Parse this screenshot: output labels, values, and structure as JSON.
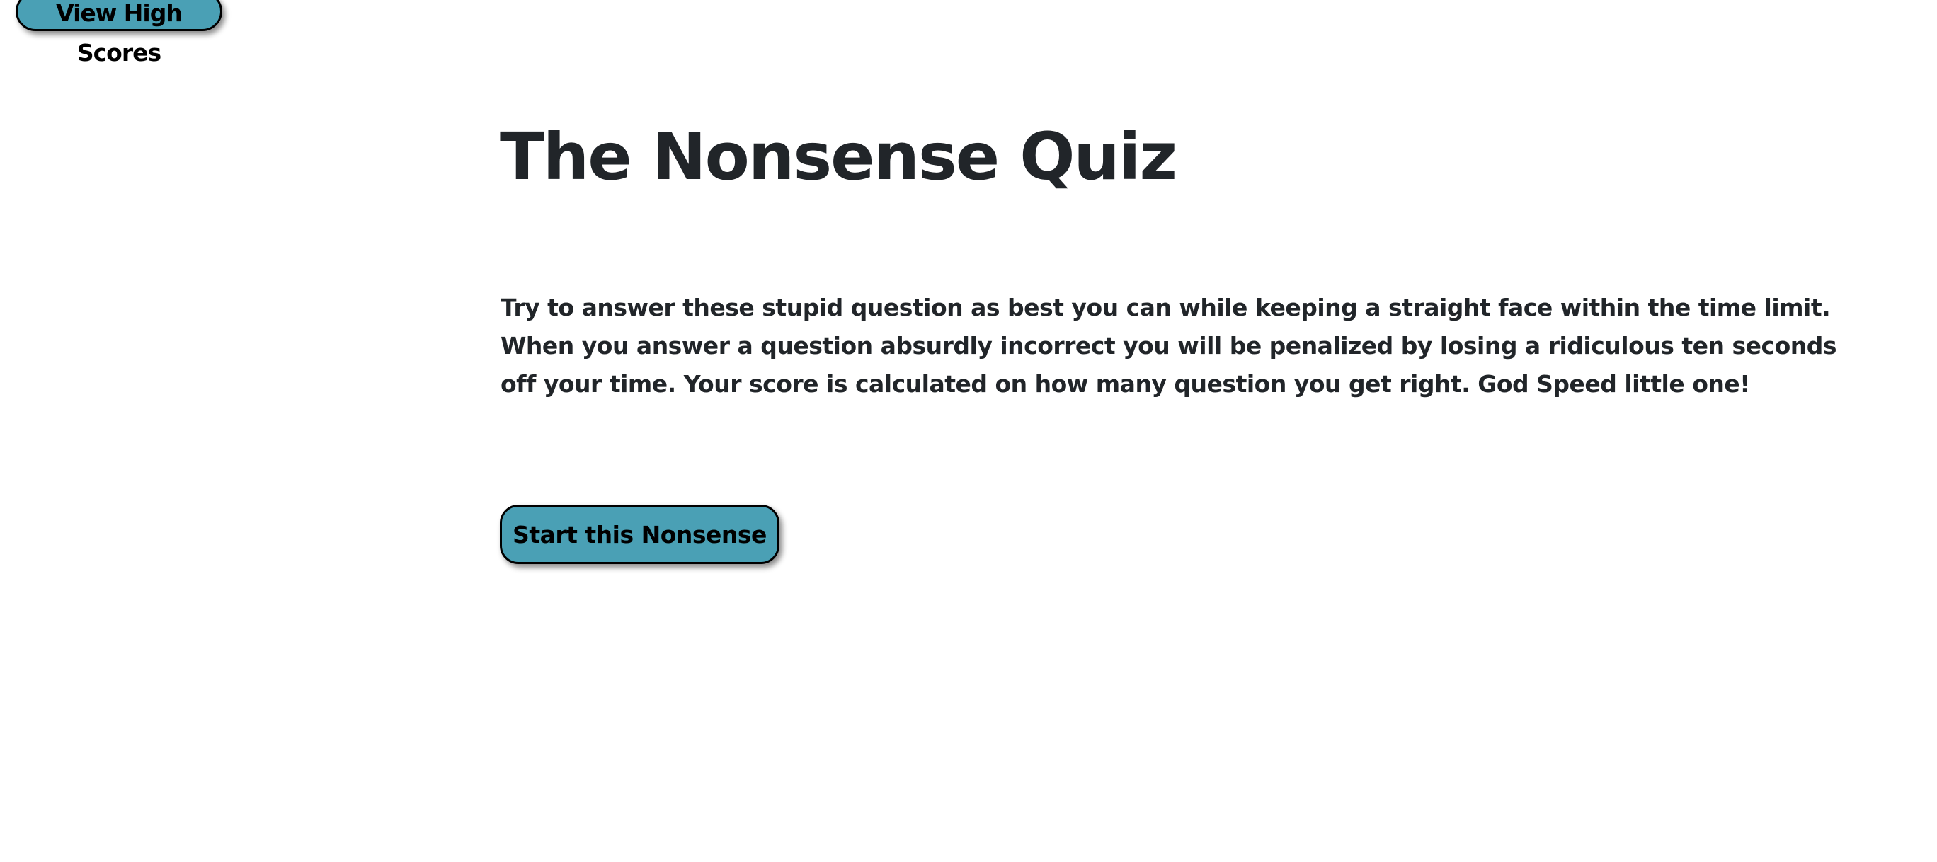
{
  "header": {
    "high_scores_label": "View High Scores"
  },
  "main": {
    "title": "The Nonsense Quiz",
    "instructions": "Try to answer these stupid question as best you can while keeping a straight face within the time limit. When you answer a question absurdly incorrect you will be penalized by losing a ridiculous ten seconds off your time. Your score is calculated on how many question you get right. God Speed little one!",
    "start_label": "Start this Nonsense"
  },
  "colors": {
    "button": "#4aa0b5",
    "text": "#212529"
  }
}
